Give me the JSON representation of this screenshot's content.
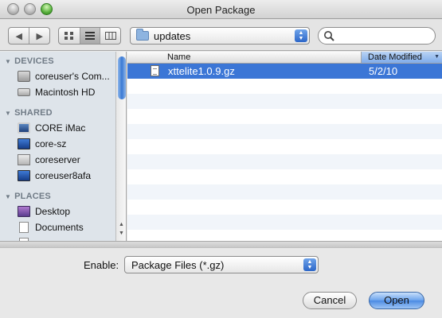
{
  "window": {
    "title": "Open Package"
  },
  "toolbar": {
    "back_icon": "◀",
    "forward_icon": "▶",
    "view_icons": [
      "icon-view-icon",
      "list-view-icon",
      "column-view-icon"
    ],
    "location": "updates",
    "search_placeholder": ""
  },
  "sidebar": {
    "sections": [
      {
        "title": "DEVICES",
        "items": [
          {
            "label": "coreuser's Com...",
            "icon": "computer-icon"
          },
          {
            "label": "Macintosh HD",
            "icon": "hard-drive-icon"
          }
        ]
      },
      {
        "title": "SHARED",
        "items": [
          {
            "label": "CORE iMac",
            "icon": "imac-icon"
          },
          {
            "label": "core-sz",
            "icon": "network-computer-icon"
          },
          {
            "label": "coreserver",
            "icon": "server-icon"
          },
          {
            "label": "coreuser8afa",
            "icon": "network-computer-icon"
          }
        ]
      },
      {
        "title": "PLACES",
        "items": [
          {
            "label": "Desktop",
            "icon": "desktop-icon"
          },
          {
            "label": "Documents",
            "icon": "documents-icon"
          }
        ]
      }
    ]
  },
  "filelist": {
    "columns": {
      "name": "Name",
      "date": "Date Modified"
    },
    "rows": [
      {
        "name": "xttelite1.0.9.gz",
        "date": "5/2/10",
        "selected": true
      }
    ]
  },
  "footer": {
    "enable_label": "Enable:",
    "enable_value": "Package Files (*.gz)",
    "cancel_label": "Cancel",
    "open_label": "Open"
  },
  "colors": {
    "selection": "#3b76d6",
    "sidebar_bg": "#dee4ea",
    "alt_row": "#f1f5fa"
  }
}
